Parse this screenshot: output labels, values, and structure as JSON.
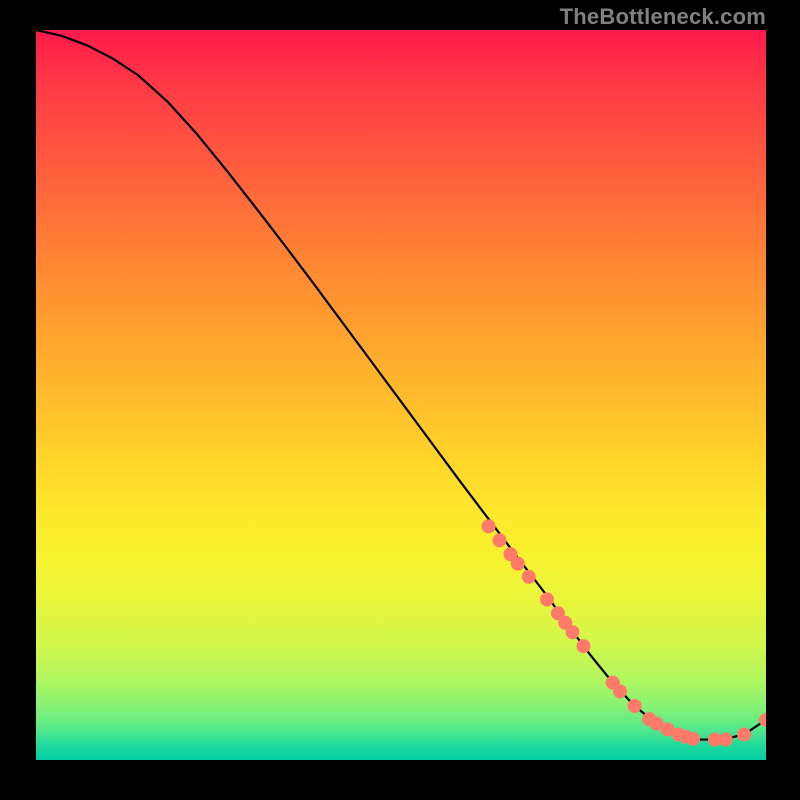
{
  "watermark": "TheBottleneck.com",
  "chart_data": {
    "type": "line",
    "xlabel": "",
    "ylabel": "",
    "title": "",
    "xlim": [
      0,
      100
    ],
    "ylim": [
      0,
      100
    ],
    "grid": false,
    "series": [
      {
        "name": "curve",
        "style": "line",
        "color": "#000000",
        "x": [
          0,
          3.5,
          7,
          10.5,
          14,
          18,
          22,
          26,
          30,
          34,
          38,
          42,
          46,
          50,
          54,
          58,
          62,
          66,
          70,
          73,
          76,
          79,
          82,
          85,
          88,
          91,
          94,
          97,
          100
        ],
        "y": [
          100,
          99.2,
          97.9,
          96.1,
          93.8,
          90.2,
          85.8,
          80.9,
          75.8,
          70.6,
          65.3,
          59.9,
          54.5,
          49.1,
          43.7,
          38.3,
          33.0,
          27.7,
          22.5,
          18.3,
          14.3,
          10.6,
          7.4,
          5.0,
          3.5,
          2.8,
          2.8,
          3.5,
          5.5
        ]
      },
      {
        "name": "markers",
        "style": "points",
        "color": "#ff7a68",
        "points": [
          {
            "x": 62.0,
            "y": 32.0
          },
          {
            "x": 63.5,
            "y": 30.1
          },
          {
            "x": 65.0,
            "y": 28.2
          },
          {
            "x": 66.0,
            "y": 26.9
          },
          {
            "x": 67.5,
            "y": 25.1
          },
          {
            "x": 70.0,
            "y": 22.0
          },
          {
            "x": 71.5,
            "y": 20.1
          },
          {
            "x": 72.5,
            "y": 18.8
          },
          {
            "x": 73.5,
            "y": 17.5
          },
          {
            "x": 75.0,
            "y": 15.6
          },
          {
            "x": 79.0,
            "y": 10.6
          },
          {
            "x": 80.0,
            "y": 9.4
          },
          {
            "x": 82.0,
            "y": 7.4
          },
          {
            "x": 84.0,
            "y": 5.6
          },
          {
            "x": 85.0,
            "y": 5.0
          },
          {
            "x": 86.5,
            "y": 4.2
          },
          {
            "x": 88.0,
            "y": 3.5
          },
          {
            "x": 89.0,
            "y": 3.2
          },
          {
            "x": 90.0,
            "y": 2.9
          },
          {
            "x": 93.0,
            "y": 2.8
          },
          {
            "x": 94.5,
            "y": 2.8
          },
          {
            "x": 97.0,
            "y": 3.5
          },
          {
            "x": 100.0,
            "y": 5.5
          }
        ]
      }
    ]
  }
}
